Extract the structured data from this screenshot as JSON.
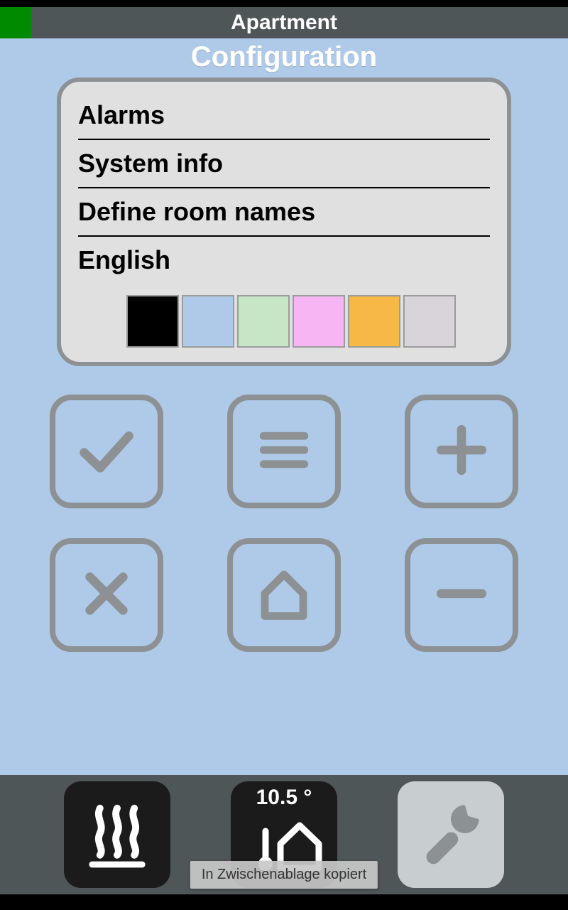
{
  "titlebar": {
    "title": "Apartment"
  },
  "section": {
    "title": "Configuration"
  },
  "menu": {
    "items": [
      {
        "label": "Alarms"
      },
      {
        "label": "System info"
      },
      {
        "label": "Define room names"
      },
      {
        "label": "English"
      }
    ]
  },
  "theme_swatches": [
    {
      "name": "black",
      "color": "#000000"
    },
    {
      "name": "blue",
      "color": "#aecae8"
    },
    {
      "name": "green",
      "color": "#c6e6c6"
    },
    {
      "name": "pink",
      "color": "#f7b6f3"
    },
    {
      "name": "orange",
      "color": "#f7b946"
    },
    {
      "name": "grey",
      "color": "#d8d4da"
    }
  ],
  "buttons": {
    "check": "check-icon",
    "menu": "menu-icon",
    "plus": "plus-icon",
    "close": "close-icon",
    "home": "home-icon",
    "minus": "minus-icon"
  },
  "bottombar": {
    "temperature": "10.5 °",
    "heating_icon": "heating-icon",
    "home_icon": "home-icon",
    "wrench_icon": "wrench-icon"
  },
  "toast": {
    "text": "In Zwischenablage kopiert"
  },
  "colors": {
    "bar": "#4f5658",
    "bg": "#aecae8",
    "border": "#8d9193",
    "led": "#008a00"
  }
}
